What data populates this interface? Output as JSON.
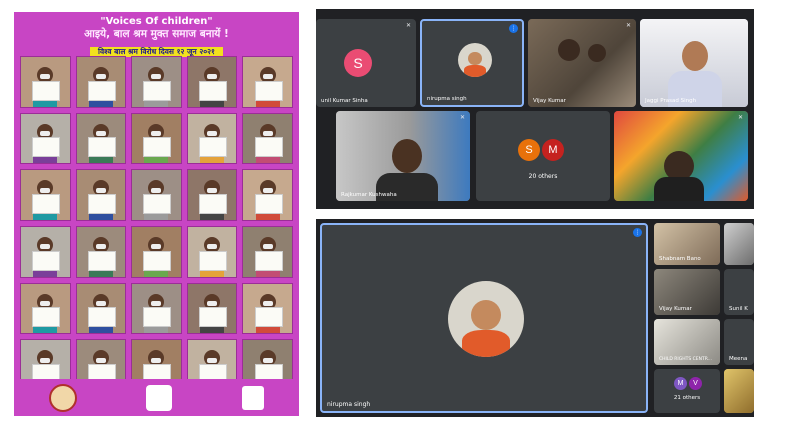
{
  "poster": {
    "title": "\"Voices  Of children\"",
    "subtitle": "आइये, बाल श्रम मुक्त समाज बनायें !",
    "date_strip": "विश्व बाल श्रम विरोध दिवस १२ जून २०२१",
    "colors": {
      "background": "#c845c4",
      "strip": "#f2e11e"
    }
  },
  "meet_top": {
    "tiles": [
      {
        "name": "unil Kumar Sinha",
        "avatar_letter": "S",
        "avatar_color": "#ea4c73"
      },
      {
        "name": "nirupma singh",
        "type": "photo-avatar",
        "pinned": true
      },
      {
        "name": "Vijay Kumar",
        "type": "video"
      },
      {
        "name": "Jaggi Prasad Singh",
        "type": "video"
      },
      {
        "name": "Rajkumar Kushwaha",
        "type": "video"
      },
      {
        "name": "20 others",
        "avatars": [
          "S",
          "M"
        ],
        "avatar_colors": [
          "#e8710a",
          "#c5221f"
        ]
      },
      {
        "name": "",
        "type": "video"
      }
    ]
  },
  "meet_bottom": {
    "main": {
      "name": "nirupma singh",
      "type": "photo-avatar",
      "pinned": true
    },
    "side": [
      {
        "name": "Shabnam Bano"
      },
      {
        "name": ""
      },
      {
        "name": "Vijay Kumar"
      },
      {
        "name": "Sunil K"
      },
      {
        "name": "CHILD RIGHTS CENTR..."
      },
      {
        "name": "Meena"
      },
      {
        "name": "21 others",
        "avatars": [
          "M",
          "V"
        ],
        "avatar_colors": [
          "#7e57c2",
          "#8e24aa"
        ]
      },
      {
        "name": ""
      }
    ]
  }
}
